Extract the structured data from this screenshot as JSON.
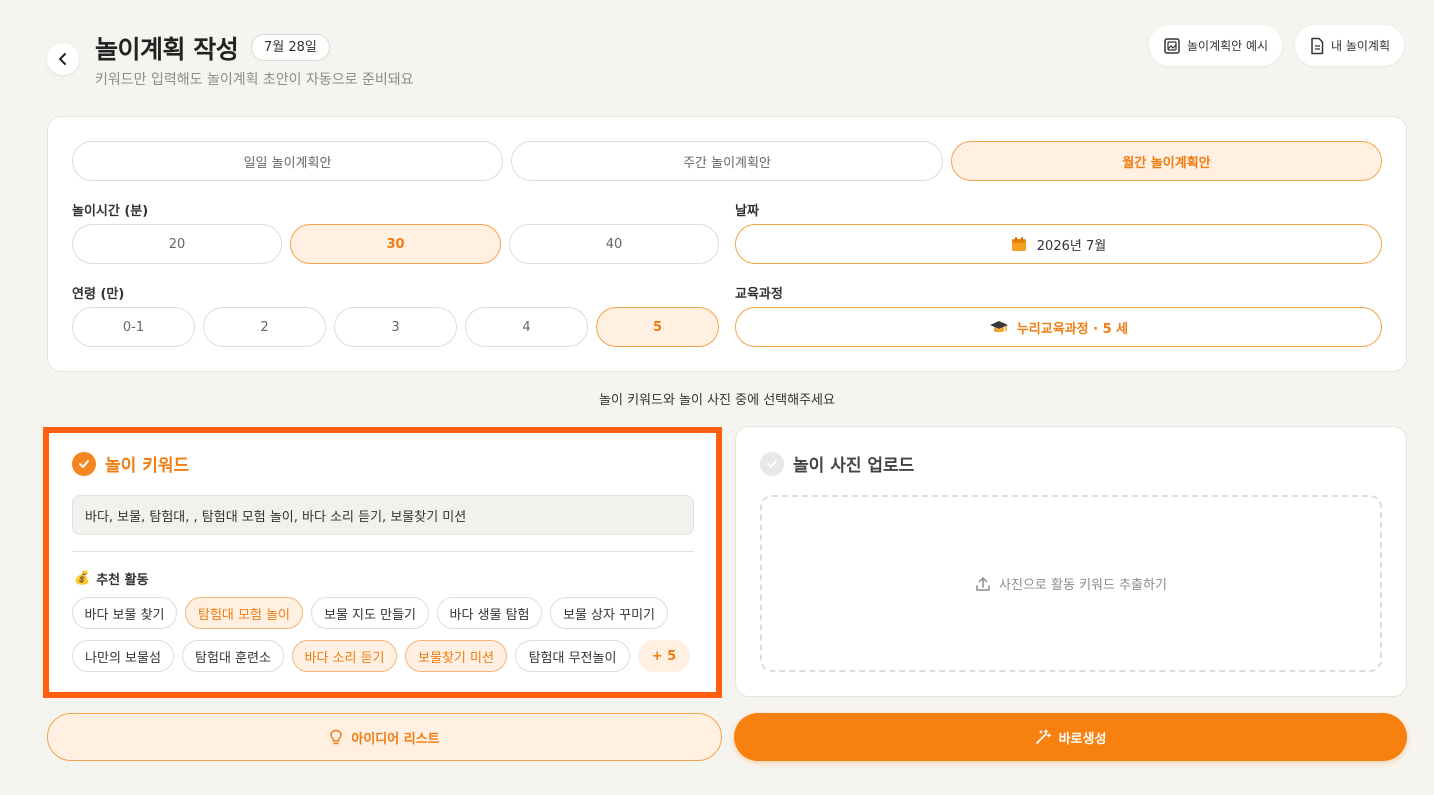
{
  "header": {
    "title": "놀이계획 작성",
    "date_badge": "7월 28일",
    "subtitle": "키워드만 입력해도 놀이계획 초안이 자동으로 준비돼요",
    "example_button": "놀이계획안 예시",
    "my_plans_button": "내 놀이계획"
  },
  "plan_types": [
    "일일 놀이계획안",
    "주간 놀이계획안",
    "월간 놀이계획안"
  ],
  "plan_type_selected": "월간 놀이계획안",
  "play_time": {
    "label": "놀이시간 (분)",
    "options": [
      "20",
      "30",
      "40"
    ],
    "selected": "30"
  },
  "date": {
    "label": "날짜",
    "value": "2026년 7월"
  },
  "age": {
    "label": "연령 (만)",
    "options": [
      "0-1",
      "2",
      "3",
      "4",
      "5"
    ],
    "selected": "5"
  },
  "curriculum": {
    "label": "교육과정",
    "value": "누리교육과정 · 5 세"
  },
  "choose_hint": "놀이 키워드와 놀이 사진 중에 선택해주세요",
  "keyword_panel": {
    "title": "놀이 키워드",
    "input_value": "바다, 보물, 탐험대, , 탐험대 모험 놀이, 바다 소리 듣기, 보물찾기 미션",
    "recommended_label": "추천 활동",
    "recommended_emoji": "💰",
    "row1": [
      "바다 보물 찾기",
      "탐험대 모험 놀이",
      "보물 지도 만들기",
      "바다 생물 탐험",
      "보물 상자 꾸미기"
    ],
    "row2": [
      "나만의 보물섬",
      "탐험대 훈련소",
      "바다 소리 듣기",
      "보물찾기 미션",
      "탐험대 무전놀이"
    ],
    "selected": [
      "탐험대 모험 놀이",
      "바다 소리 듣기",
      "보물찾기 미션"
    ],
    "more": "+ 5"
  },
  "photo_panel": {
    "title": "놀이 사진 업로드",
    "upload_text": "사진으로 활동 키워드 추출하기"
  },
  "buttons": {
    "idea_list": "아이디어 리스트",
    "generate": "바로생성"
  },
  "colors": {
    "accent": "#f7800f",
    "accent_soft": "#fff0e2",
    "highlight_border": "#ff5f0f",
    "background": "#f6f4ef"
  }
}
